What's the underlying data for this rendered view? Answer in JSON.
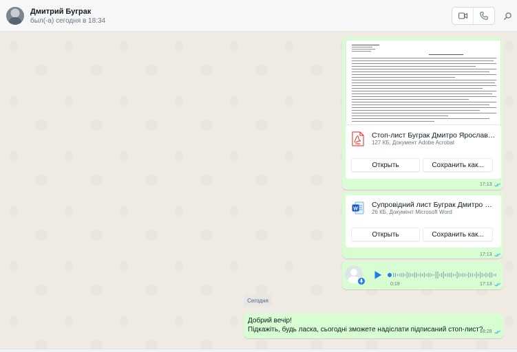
{
  "header": {
    "contact_name": "Дмитрий Буграк",
    "status": "был(-а) сегодня в 18:34",
    "icons": [
      "video-call-icon",
      "voice-call-icon",
      "search-icon"
    ]
  },
  "messages": {
    "pdf": {
      "file_name": "Стоп-лист Буграк Дмитро Ярославови...",
      "file_info": "127 КБ, Документ Adobe Acrobat",
      "open_label": "Открыть",
      "save_label": "Сохранить как...",
      "time": "17:13",
      "icon": "pdf-file-icon"
    },
    "word": {
      "file_name": "Супровідний лист Буграк Дмитро Яро...",
      "file_info": "26 КБ, Документ Microsoft Word",
      "open_label": "Открыть",
      "save_label": "Сохранить как...",
      "time": "17:13",
      "icon": "word-file-icon"
    },
    "voice": {
      "duration": "0:19",
      "time": "17:13",
      "progress": 0
    },
    "date_divider": "Сегодня",
    "text": {
      "line1": "Добрий вечір!",
      "line2": "Підкажіть, будь ласка, сьогодні зможете надіслати підписаний стоп-лист?",
      "time": "18:28"
    }
  },
  "colors": {
    "outgoing_bubble": "#d9fdd3",
    "chat_background": "#efeae2",
    "read_ticks": "#53bdeb",
    "pdf_red": "#e2231a",
    "word_blue": "#185abd",
    "play_blue": "#1f7aec"
  }
}
